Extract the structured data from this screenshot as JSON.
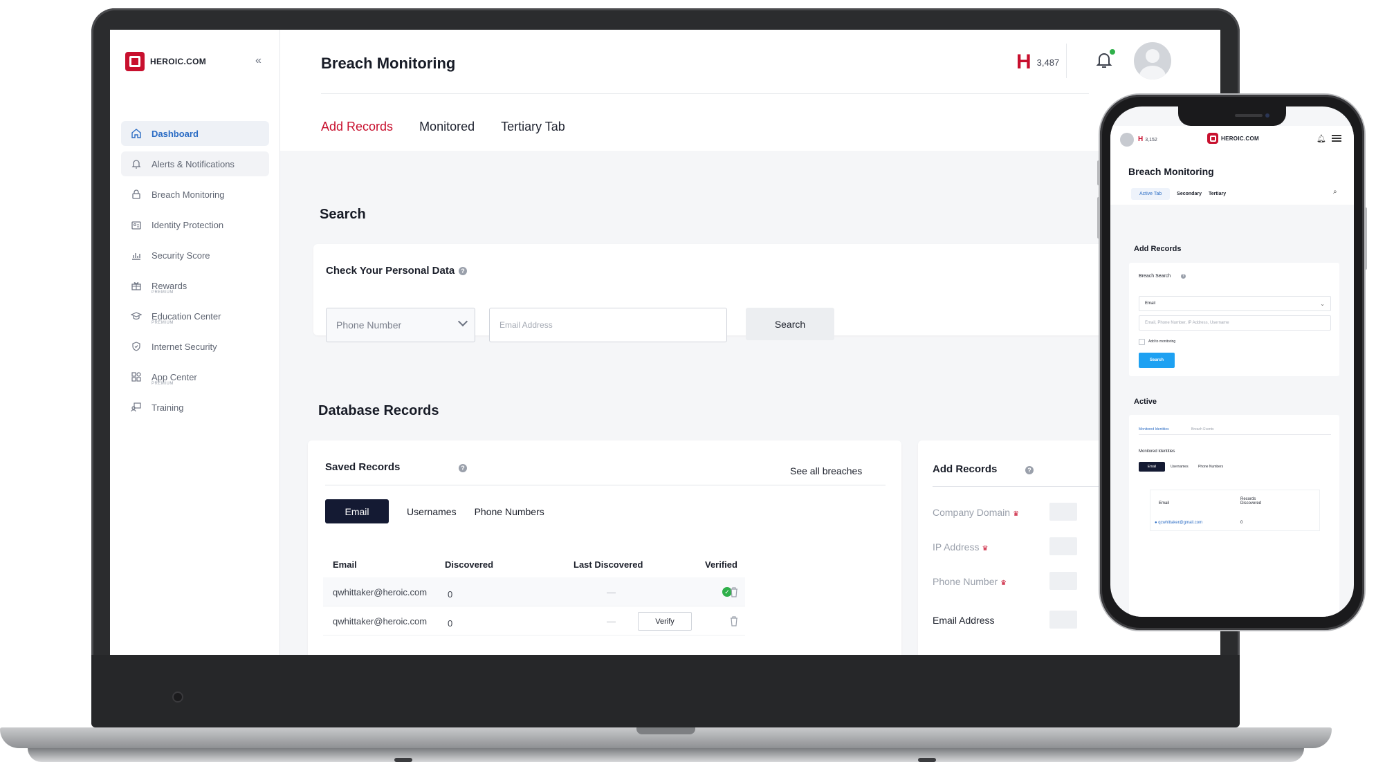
{
  "brand": {
    "name": "HEROIC.COM",
    "collapse_icon": "«"
  },
  "sidebar": {
    "items": [
      {
        "label": "Dashboard",
        "icon": "home-icon",
        "sub": ""
      },
      {
        "label": "Alerts & Notifications",
        "icon": "bell-icon",
        "sub": ""
      },
      {
        "label": "Breach Monitoring",
        "icon": "lock-icon",
        "sub": ""
      },
      {
        "label": "Identity Protection",
        "icon": "id-card-icon",
        "sub": ""
      },
      {
        "label": "Security Score",
        "icon": "bar-chart-icon",
        "sub": ""
      },
      {
        "label": "Rewards",
        "icon": "gift-icon",
        "sub": "PREMIUM"
      },
      {
        "label": "Education Center",
        "icon": "graduation-cap-icon",
        "sub": "PREMIUM"
      },
      {
        "label": "Internet Security",
        "icon": "shield-icon",
        "sub": ""
      },
      {
        "label": "App Center",
        "icon": "apps-grid-icon",
        "sub": "PREMIUM"
      },
      {
        "label": "Training",
        "icon": "training-icon",
        "sub": ""
      }
    ]
  },
  "header": {
    "title": "Breach Monitoring",
    "points": "3,487"
  },
  "tabs": [
    "Add Records",
    "Monitored",
    "Tertiary Tab"
  ],
  "search": {
    "section_title": "Search",
    "card_title": "Check Your Personal Data",
    "select_value": "Phone Number",
    "input_placeholder": "Email Address",
    "button": "Search"
  },
  "database": {
    "section_title": "Database Records",
    "saved": {
      "title": "Saved Records",
      "see_all": "See all breaches",
      "sub_tabs": [
        "Email",
        "Usernames",
        "Phone Numbers"
      ],
      "columns": [
        "Email",
        "Discovered",
        "Last Discovered",
        "Verified"
      ],
      "rows": [
        {
          "email": "qwhittaker@heroic.com",
          "discovered": "0",
          "last": "—",
          "verified": true
        },
        {
          "email": "qwhittaker@heroic.com",
          "discovered": "0",
          "last": "—",
          "verified": false,
          "action": "Verify"
        }
      ]
    },
    "add": {
      "title": "Add Records",
      "fields": [
        "Company Domain",
        "IP Address",
        "Phone Number",
        "Email Address"
      ]
    }
  },
  "mobile": {
    "points": "3,152",
    "title": "Breach Monitoring",
    "tabs": [
      "Active Tab",
      "Secondary",
      "Tertiary"
    ],
    "add_title": "Add Records",
    "breach_search": "Breach Search",
    "select_value": "Email",
    "input_placeholder": "Email, Phone Number, IP Address, Username",
    "checkbox_label": "Add to monitoring",
    "button": "Search",
    "active_title": "Active",
    "active_tabs": [
      "Monitored Identities",
      "Breach Events"
    ],
    "monitored_title": "Monitored Identities",
    "sub_tabs": [
      "Email",
      "Usernames",
      "Phone Numbers"
    ],
    "columns": [
      "Email",
      "Records Discovered"
    ],
    "row": {
      "email": "qcwhittaker@gmail.com",
      "records": "0"
    }
  },
  "colors": {
    "brand_red": "#c8102e",
    "accent_blue": "#2b6cc4",
    "navy": "#141a33",
    "success": "#2fb04a",
    "mobile_button": "#1ea1f2"
  }
}
